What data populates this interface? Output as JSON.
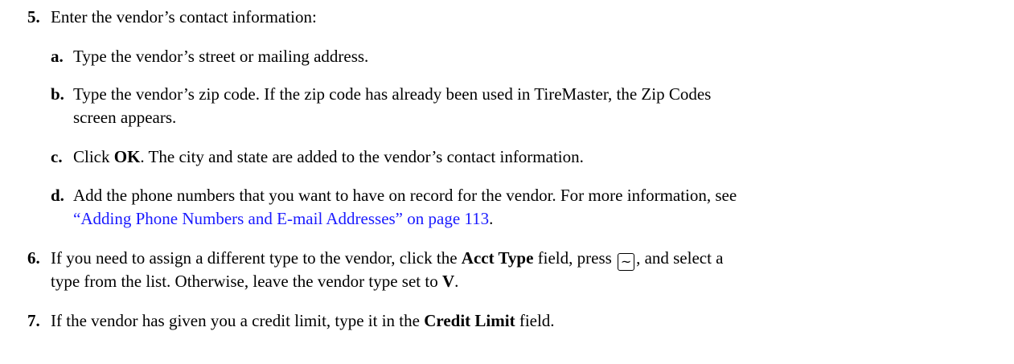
{
  "steps": [
    {
      "number": "5.",
      "text": "Enter the vendor’s contact information:",
      "substeps": [
        {
          "letter": "a.",
          "text": "Type the vendor’s street or mailing address."
        },
        {
          "letter": "b.",
          "line1": "Type the vendor’s zip code. If the zip code has already been used in TireMaster, the Zip Codes",
          "line2": "screen appears."
        },
        {
          "letter": "c.",
          "pre": "Click ",
          "bold": "OK",
          "post": ". The city and state are added to the vendor’s contact information."
        },
        {
          "letter": "d.",
          "line1": "Add the phone numbers that you want to have on record for the vendor. For more information, see",
          "link": "“Adding Phone Numbers and E-mail Addresses” on page 113",
          "after_link": "."
        }
      ]
    },
    {
      "number": "6.",
      "pre": "If you need to assign a different type to the vendor, click the ",
      "bold1": "Acct Type",
      "mid": " field, press ",
      "key": "~",
      "post": ", and select a",
      "line2_pre": "type from the list. Otherwise, leave the vendor type set to ",
      "bold2": "V",
      "line2_post": "."
    },
    {
      "number": "7.",
      "pre": "If the vendor has given you a credit limit, type it in the ",
      "bold": "Credit Limit",
      "post": " field."
    }
  ],
  "colors": {
    "text": "#000000",
    "link": "#1a1aff"
  }
}
